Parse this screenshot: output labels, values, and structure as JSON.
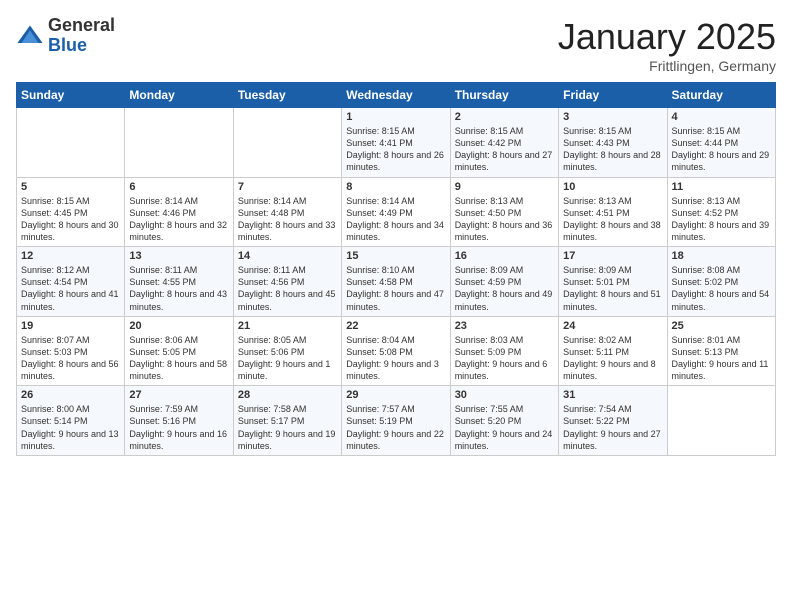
{
  "logo": {
    "general": "General",
    "blue": "Blue"
  },
  "title": "January 2025",
  "subtitle": "Frittlingen, Germany",
  "days_of_week": [
    "Sunday",
    "Monday",
    "Tuesday",
    "Wednesday",
    "Thursday",
    "Friday",
    "Saturday"
  ],
  "weeks": [
    [
      {
        "day": "",
        "content": ""
      },
      {
        "day": "",
        "content": ""
      },
      {
        "day": "",
        "content": ""
      },
      {
        "day": "1",
        "content": "Sunrise: 8:15 AM\nSunset: 4:41 PM\nDaylight: 8 hours and 26 minutes."
      },
      {
        "day": "2",
        "content": "Sunrise: 8:15 AM\nSunset: 4:42 PM\nDaylight: 8 hours and 27 minutes."
      },
      {
        "day": "3",
        "content": "Sunrise: 8:15 AM\nSunset: 4:43 PM\nDaylight: 8 hours and 28 minutes."
      },
      {
        "day": "4",
        "content": "Sunrise: 8:15 AM\nSunset: 4:44 PM\nDaylight: 8 hours and 29 minutes."
      }
    ],
    [
      {
        "day": "5",
        "content": "Sunrise: 8:15 AM\nSunset: 4:45 PM\nDaylight: 8 hours and 30 minutes."
      },
      {
        "day": "6",
        "content": "Sunrise: 8:14 AM\nSunset: 4:46 PM\nDaylight: 8 hours and 32 minutes."
      },
      {
        "day": "7",
        "content": "Sunrise: 8:14 AM\nSunset: 4:48 PM\nDaylight: 8 hours and 33 minutes."
      },
      {
        "day": "8",
        "content": "Sunrise: 8:14 AM\nSunset: 4:49 PM\nDaylight: 8 hours and 34 minutes."
      },
      {
        "day": "9",
        "content": "Sunrise: 8:13 AM\nSunset: 4:50 PM\nDaylight: 8 hours and 36 minutes."
      },
      {
        "day": "10",
        "content": "Sunrise: 8:13 AM\nSunset: 4:51 PM\nDaylight: 8 hours and 38 minutes."
      },
      {
        "day": "11",
        "content": "Sunrise: 8:13 AM\nSunset: 4:52 PM\nDaylight: 8 hours and 39 minutes."
      }
    ],
    [
      {
        "day": "12",
        "content": "Sunrise: 8:12 AM\nSunset: 4:54 PM\nDaylight: 8 hours and 41 minutes."
      },
      {
        "day": "13",
        "content": "Sunrise: 8:11 AM\nSunset: 4:55 PM\nDaylight: 8 hours and 43 minutes."
      },
      {
        "day": "14",
        "content": "Sunrise: 8:11 AM\nSunset: 4:56 PM\nDaylight: 8 hours and 45 minutes."
      },
      {
        "day": "15",
        "content": "Sunrise: 8:10 AM\nSunset: 4:58 PM\nDaylight: 8 hours and 47 minutes."
      },
      {
        "day": "16",
        "content": "Sunrise: 8:09 AM\nSunset: 4:59 PM\nDaylight: 8 hours and 49 minutes."
      },
      {
        "day": "17",
        "content": "Sunrise: 8:09 AM\nSunset: 5:01 PM\nDaylight: 8 hours and 51 minutes."
      },
      {
        "day": "18",
        "content": "Sunrise: 8:08 AM\nSunset: 5:02 PM\nDaylight: 8 hours and 54 minutes."
      }
    ],
    [
      {
        "day": "19",
        "content": "Sunrise: 8:07 AM\nSunset: 5:03 PM\nDaylight: 8 hours and 56 minutes."
      },
      {
        "day": "20",
        "content": "Sunrise: 8:06 AM\nSunset: 5:05 PM\nDaylight: 8 hours and 58 minutes."
      },
      {
        "day": "21",
        "content": "Sunrise: 8:05 AM\nSunset: 5:06 PM\nDaylight: 9 hours and 1 minute."
      },
      {
        "day": "22",
        "content": "Sunrise: 8:04 AM\nSunset: 5:08 PM\nDaylight: 9 hours and 3 minutes."
      },
      {
        "day": "23",
        "content": "Sunrise: 8:03 AM\nSunset: 5:09 PM\nDaylight: 9 hours and 6 minutes."
      },
      {
        "day": "24",
        "content": "Sunrise: 8:02 AM\nSunset: 5:11 PM\nDaylight: 9 hours and 8 minutes."
      },
      {
        "day": "25",
        "content": "Sunrise: 8:01 AM\nSunset: 5:13 PM\nDaylight: 9 hours and 11 minutes."
      }
    ],
    [
      {
        "day": "26",
        "content": "Sunrise: 8:00 AM\nSunset: 5:14 PM\nDaylight: 9 hours and 13 minutes."
      },
      {
        "day": "27",
        "content": "Sunrise: 7:59 AM\nSunset: 5:16 PM\nDaylight: 9 hours and 16 minutes."
      },
      {
        "day": "28",
        "content": "Sunrise: 7:58 AM\nSunset: 5:17 PM\nDaylight: 9 hours and 19 minutes."
      },
      {
        "day": "29",
        "content": "Sunrise: 7:57 AM\nSunset: 5:19 PM\nDaylight: 9 hours and 22 minutes."
      },
      {
        "day": "30",
        "content": "Sunrise: 7:55 AM\nSunset: 5:20 PM\nDaylight: 9 hours and 24 minutes."
      },
      {
        "day": "31",
        "content": "Sunrise: 7:54 AM\nSunset: 5:22 PM\nDaylight: 9 hours and 27 minutes."
      },
      {
        "day": "",
        "content": ""
      }
    ]
  ]
}
